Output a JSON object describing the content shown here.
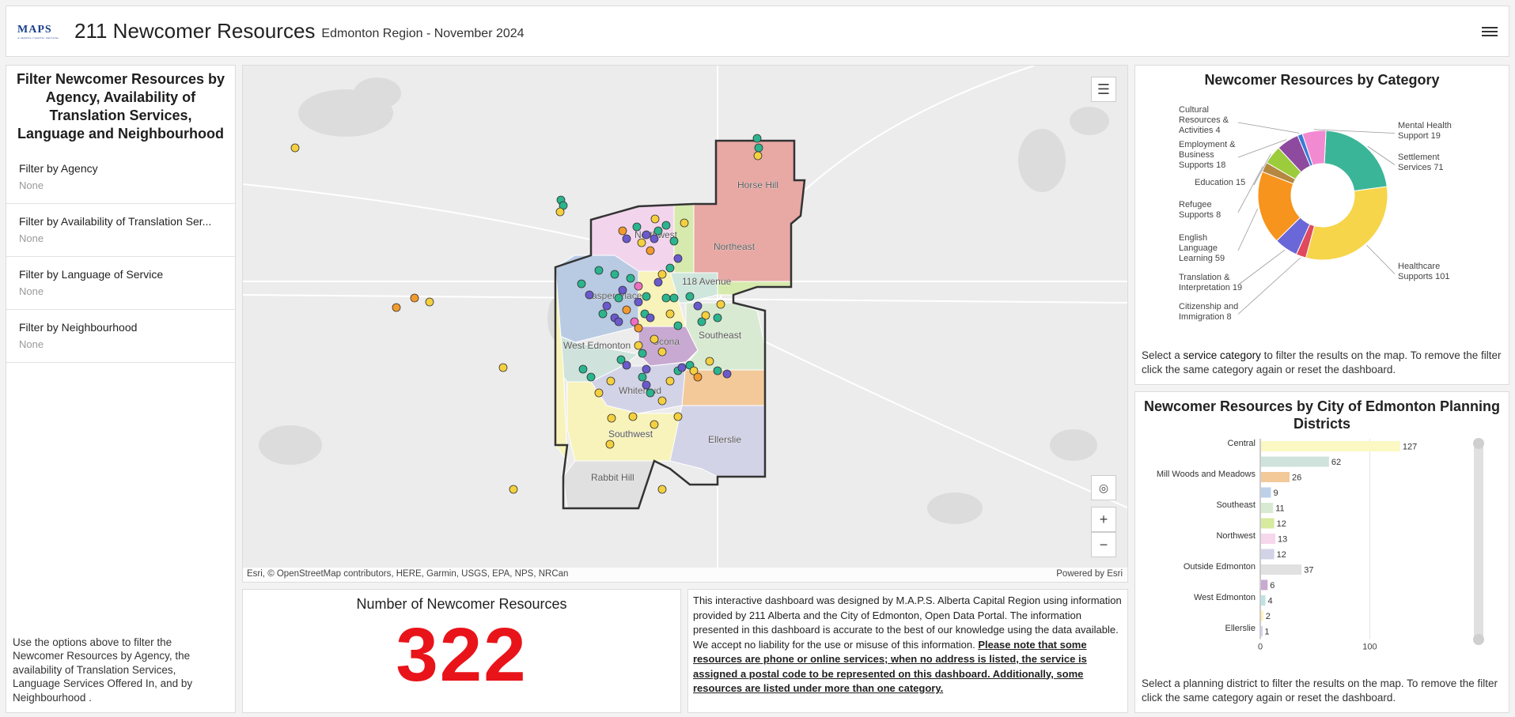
{
  "header": {
    "logo": "MAPS",
    "logo_sub": "ALBERTA CAPITAL REGION",
    "title": "211 Newcomer Resources",
    "subtitle": "Edmonton Region - November 2024"
  },
  "filters": {
    "title": "Filter Newcomer Resources by Agency, Availability of Translation Services, Language and Neighbourhood",
    "items": [
      {
        "label": "Filter by Agency",
        "value": "None"
      },
      {
        "label": "Filter by Availability of Translation Ser...",
        "value": "None"
      },
      {
        "label": "Filter by Language of Service",
        "value": "None"
      },
      {
        "label": "Filter by Neighbourhood",
        "value": "None"
      }
    ],
    "note": "Use the options above to filter the Newcomer Resources by Agency, the availability of Translation Services, Language Services Offered In, and by Neighbourhood ."
  },
  "map": {
    "attribution": "Esri, © OpenStreetMap contributors, HERE, Garmin, USGS, EPA, NPS, NRCan",
    "powered": "Powered by Esri",
    "districts": [
      "Horse Hill",
      "Northwest",
      "Northeast",
      "118 Avenue",
      "Jasper Place",
      "Scona",
      "Southeast",
      "West Edmonton",
      "Whitemud",
      "Southwest",
      "Ellerslie",
      "Rabbit Hill"
    ],
    "colors": {
      "point_yellow": "#f4d03f",
      "point_green": "#2bb48d",
      "point_blue": "#6a5acd",
      "point_orange": "#f39a2c",
      "point_pink": "#ee6fbf"
    }
  },
  "count": {
    "title": "Number of Newcomer Resources",
    "value": "322"
  },
  "disclaimer": {
    "text": "This interactive dashboard was designed by M.A.P.S. Alberta Capital Region using information provided by 211 Alberta and the City of Edmonton, Open Data Portal. The information presented in this dashboard is accurate to the best of our knowledge using the data available. We accept no liability for the use or misuse of this information. ",
    "emphasis": "Please note that some resources are phone or online services; when no address is listed, the service is assigned a postal code to be represented on this dashboard. Additionally, some resources are listed under more than one category."
  },
  "category_chart": {
    "title": "Newcomer Resources by Category",
    "note_pre": "Select a ",
    "note_link": "service category",
    "note_post": " to filter the results on the map. To remove the filter click the same category again or reset the dashboard.",
    "chart_data": {
      "type": "pie",
      "title": "Newcomer Resources by Category",
      "slices": [
        {
          "label": "Settlement Services",
          "value": 71,
          "color": "#3bb598"
        },
        {
          "label": "Healthcare Supports",
          "value": 101,
          "color": "#f6d54a"
        },
        {
          "label": "Citizenship and Immigration",
          "value": 8,
          "color": "#e04a5c"
        },
        {
          "label": "Translation & Interpretation",
          "value": 19,
          "color": "#6a67d8"
        },
        {
          "label": "English Language Learning",
          "value": 59,
          "color": "#f7941d"
        },
        {
          "label": "Refugee Supports",
          "value": 8,
          "color": "#b5873f"
        },
        {
          "label": "Education",
          "value": 15,
          "color": "#9ccc3c"
        },
        {
          "label": "Employment & Business Supports",
          "value": 18,
          "color": "#8e4a9e"
        },
        {
          "label": "Cultural Resources & Activities",
          "value": 4,
          "color": "#3a7bd5"
        },
        {
          "label": "Mental Health Support",
          "value": 19,
          "color": "#f28ad2"
        }
      ]
    }
  },
  "district_chart": {
    "title": "Newcomer Resources by City of Edmonton Planning Districts",
    "note": "Select a planning district to filter the results on the map. To remove the filter click the same category again or reset the dashboard.",
    "chart_data": {
      "type": "bar",
      "orientation": "horizontal",
      "categories": [
        "Central",
        "",
        "Mill Woods and Meadows",
        "",
        "Southeast",
        "",
        "Northwest",
        "",
        "Outside Edmonton",
        "",
        "West Edmonton",
        "",
        "Ellerslie"
      ],
      "values": [
        127,
        62,
        26,
        9,
        11,
        12,
        13,
        12,
        37,
        6,
        4,
        2,
        1
      ],
      "colors": [
        "#fbf8c3",
        "#cfe3dc",
        "#f3c99a",
        "#bdd0ea",
        "#d9ead3",
        "#d7ea9d",
        "#f6d7ec",
        "#d3d3e8",
        "#e1e1e1",
        "#c8a9d1",
        "#bfe2e2",
        "#fdf2b8",
        "#cfd3ea"
      ],
      "xlim": [
        0,
        130
      ],
      "xticks": [
        0,
        100
      ]
    }
  }
}
